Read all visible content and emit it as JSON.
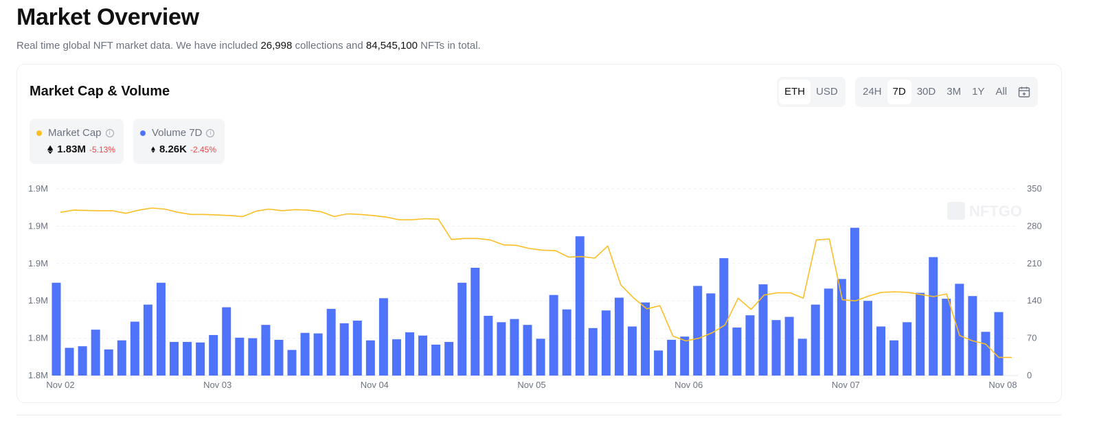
{
  "header": {
    "title": "Market Overview",
    "subtitle_pre": "Real time global NFT market data. We have included ",
    "collections": "26,998",
    "subtitle_mid": " collections and ",
    "nfts": "84,545,100",
    "subtitle_post": " NFTs in total."
  },
  "card": {
    "title": "Market Cap & Volume",
    "currency_options": [
      "ETH",
      "USD"
    ],
    "currency_selected": "ETH",
    "range_options": [
      "24H",
      "7D",
      "30D",
      "3M",
      "1Y",
      "All"
    ],
    "range_selected": "7D",
    "calendar_icon": "calendar-icon"
  },
  "legend": {
    "market_cap": {
      "label": "Market Cap",
      "value": "1.83M",
      "change": "-5.13%"
    },
    "volume": {
      "label": "Volume 7D",
      "value": "8.26K",
      "change": "-2.45%"
    }
  },
  "colors": {
    "market_cap": "#fbbf24",
    "volume": "#4f74f9",
    "negative": "#ef4444"
  },
  "watermark": "NFTGO",
  "chart_data": {
    "type": "bar",
    "x_ticks": [
      "Nov 02",
      "Nov 03",
      "Nov 04",
      "Nov 05",
      "Nov 06",
      "Nov 07",
      "Nov 08"
    ],
    "y_left_ticks": [
      "1.8M",
      "1.8M",
      "1.9M",
      "1.9M",
      "1.9M",
      "1.9M"
    ],
    "y_right_ticks": [
      "0",
      "70",
      "140",
      "210",
      "280",
      "350"
    ],
    "y_right_range": [
      0,
      350
    ],
    "grid": "horizontal dashed",
    "series": [
      {
        "name": "Volume 7D",
        "type": "bar",
        "axis": "right",
        "values": [
          174,
          52,
          55,
          86,
          49,
          66,
          101,
          133,
          174,
          63,
          63,
          62,
          76,
          128,
          71,
          70,
          95,
          67,
          48,
          80,
          79,
          125,
          98,
          103,
          66,
          145,
          68,
          81,
          75,
          58,
          63,
          174,
          202,
          112,
          100,
          106,
          95,
          69,
          151,
          124,
          261,
          89,
          122,
          146,
          92,
          137,
          47,
          67,
          73,
          168,
          154,
          220,
          90,
          113,
          171,
          104,
          110,
          69,
          133,
          163,
          181,
          277,
          140,
          92,
          66,
          100,
          155,
          222,
          144,
          172,
          149,
          82,
          119
        ],
        "x_range": [
          0,
          72
        ]
      },
      {
        "name": "Market Cap",
        "type": "line",
        "axis": "right",
        "note": "values in right-axis units as drawn",
        "x_range": [
          0,
          72
        ],
        "points": [
          [
            0,
            306
          ],
          [
            1,
            310
          ],
          [
            3,
            309
          ],
          [
            4,
            309
          ],
          [
            5,
            304
          ],
          [
            6,
            310
          ],
          [
            7,
            314
          ],
          [
            8,
            312
          ],
          [
            9,
            306
          ],
          [
            10,
            302
          ],
          [
            11,
            302
          ],
          [
            12,
            301
          ],
          [
            13,
            300
          ],
          [
            14,
            298
          ],
          [
            15,
            308
          ],
          [
            16,
            312
          ],
          [
            17,
            309
          ],
          [
            18,
            311
          ],
          [
            19,
            310
          ],
          [
            20,
            307
          ],
          [
            21,
            298
          ],
          [
            22,
            303
          ],
          [
            23,
            302
          ],
          [
            24,
            300
          ],
          [
            25,
            297
          ],
          [
            26,
            292
          ],
          [
            27,
            292
          ],
          [
            28,
            294
          ],
          [
            29,
            293
          ],
          [
            30,
            255
          ],
          [
            31,
            257
          ],
          [
            32,
            257
          ],
          [
            33,
            254
          ],
          [
            34,
            245
          ],
          [
            35,
            244
          ],
          [
            36,
            238
          ],
          [
            37,
            235
          ],
          [
            38,
            234
          ],
          [
            39,
            222
          ],
          [
            40,
            223
          ],
          [
            41,
            220
          ],
          [
            42,
            243
          ],
          [
            43,
            170
          ],
          [
            44,
            145
          ],
          [
            45,
            125
          ],
          [
            46,
            131
          ],
          [
            47,
            74
          ],
          [
            48,
            65
          ],
          [
            49,
            70
          ],
          [
            50,
            80
          ],
          [
            51,
            95
          ],
          [
            52,
            145
          ],
          [
            53,
            124
          ],
          [
            54,
            151
          ],
          [
            55,
            155
          ],
          [
            56,
            155
          ],
          [
            57,
            145
          ],
          [
            58,
            254
          ],
          [
            59,
            256
          ],
          [
            60,
            142
          ],
          [
            61,
            140
          ],
          [
            62,
            149
          ],
          [
            63,
            156
          ],
          [
            64,
            157
          ],
          [
            65,
            156
          ],
          [
            66,
            152
          ],
          [
            67,
            148
          ],
          [
            68,
            153
          ],
          [
            69,
            75
          ],
          [
            70,
            65
          ],
          [
            71,
            59
          ],
          [
            72,
            34
          ],
          [
            73,
            34
          ]
        ]
      }
    ]
  }
}
